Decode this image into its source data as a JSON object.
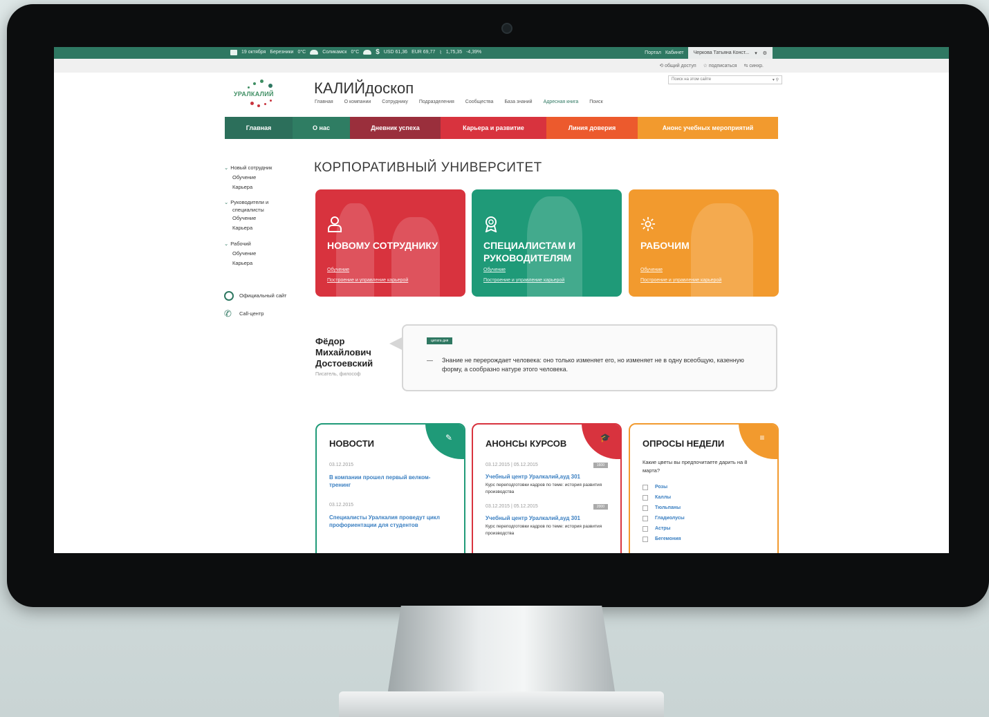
{
  "topbar": {
    "date": "19 октября",
    "weather1_city": "Березники",
    "weather1_temp": "0°C",
    "weather2_city": "Соликамск",
    "weather2_temp": "0°C",
    "usd": "USD 61,36",
    "eur": "EUR 69,77",
    "index": "1,75,35",
    "index_change": "-4,39%",
    "link_portal": "Портал",
    "link_cabinet": "Кабинет",
    "user": "Черкова Татьяна Конст...",
    "gear_icon": "gear-icon"
  },
  "subbar": {
    "share": "общий доступ",
    "subscribe": "подписаться",
    "sync": "синхр."
  },
  "header": {
    "logo_text": "УРАЛКАЛИЙ",
    "site_title": "КАЛИЙдоскоп",
    "search_placeholder": "Поиск на этом сайте",
    "nav": [
      "Главная",
      "О компании",
      "Сотруднику",
      "Подразделения",
      "Сообщества",
      "База знаний",
      "Адресная книга",
      "Поиск"
    ]
  },
  "mainnav": [
    {
      "label": "Главная",
      "color": "#2c6f5b"
    },
    {
      "label": "О нас",
      "color": "#2f7d63"
    },
    {
      "label": "Дневник успеха",
      "color": "#9a2f3c"
    },
    {
      "label": "Карьера и развитие",
      "color": "#d8333e"
    },
    {
      "label": "Линия доверия",
      "color": "#ec5a2d"
    },
    {
      "label": "Анонс учебных мероприятий",
      "color": "#f29a2e"
    }
  ],
  "sidebar": {
    "groups": [
      {
        "head": "Новый сотрудник",
        "items": [
          "Обучение",
          "Карьера"
        ]
      },
      {
        "head": "Руководители и специалисты",
        "items": [
          "Обучение",
          "Карьера"
        ]
      },
      {
        "head": "Рабочий",
        "items": [
          "Обучение",
          "Карьера"
        ]
      }
    ],
    "official_site": "Официальный сайт",
    "call_center": "Call-центр"
  },
  "page_title": "КОРПОРАТИВНЫЙ УНИВЕРСИТЕТ",
  "tiles": [
    {
      "title": "НОВОМУ СОТРУДНИКУ",
      "link1": "Обучение",
      "link2": "Построение и управление карьерой",
      "color": "#d8333e",
      "icon": "person-icon"
    },
    {
      "title": "СПЕЦИАЛИСТАМ И РУКОВОДИТЕЛЯМ",
      "link1": "Обучение",
      "link2": "Построение и управление карьерой",
      "color": "#1f9a78",
      "icon": "award-icon"
    },
    {
      "title": "РАБОЧИМ",
      "link1": "Обучение",
      "link2": "Построение и управление карьерой",
      "color": "#f29a2e",
      "icon": "gear-icon"
    }
  ],
  "quote": {
    "author": "Фёдор Михайлович Достоевский",
    "role": "Писатель, философ",
    "badge": "цитата дня",
    "text": "Знание не перерождает человека: оно только изменяет его, но изменяет не в одну всеобщую, казенную форму, а сообразно натуре этого человека."
  },
  "news": {
    "title": "НОВОСТИ",
    "color": "#1f9a78",
    "items": [
      {
        "date": "03.12.2015",
        "title": "В компании прошел первый велком-тренинг"
      },
      {
        "date": "03.12.2015",
        "title": "Специалисты Уралкалия проведут цикл профориентации для студентов"
      }
    ]
  },
  "courses": {
    "title": "АНОНСЫ КУРСОВ",
    "color": "#d8333e",
    "items": [
      {
        "dates": "03.12.2015 | 05.12.2015",
        "tag": "1600",
        "title": "Учебный центр Уралкалий,ауд 301",
        "desc": "Курс переподготовки кадров по теме: история развития производства"
      },
      {
        "dates": "03.12.2015 | 05.12.2015",
        "tag": "2000",
        "title": "Учебный центр Уралкалий,ауд 301",
        "desc": "Курс переподготовки кадров по теме: история развития производства"
      }
    ]
  },
  "poll": {
    "title": "ОПРОСЫ НЕДЕЛИ",
    "color": "#f29a2e",
    "question": "Какие цветы вы предпочитаете дарить на 8 марта?",
    "options": [
      "Розы",
      "Каллы",
      "Тюльпаны",
      "Гладиолусы",
      "Астры",
      "Бегемония"
    ]
  }
}
